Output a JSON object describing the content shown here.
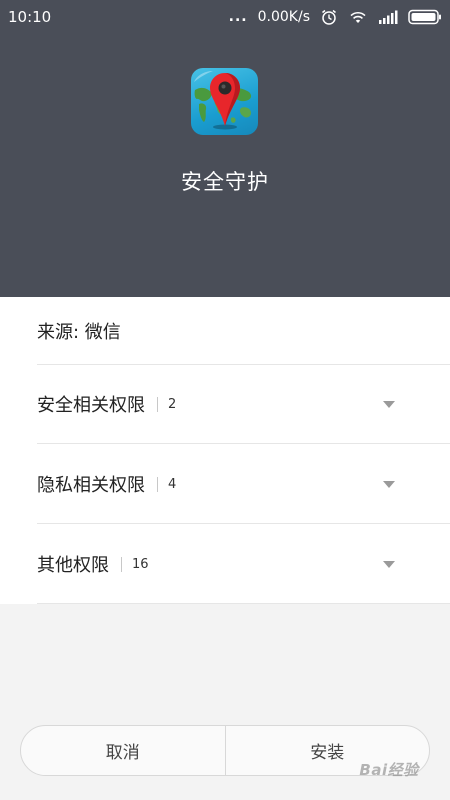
{
  "status_bar": {
    "time": "10:10",
    "dots": "...",
    "speed": "0.00K/s"
  },
  "app": {
    "name": "安全守护",
    "icon": "map-pin-globe-icon"
  },
  "source": {
    "label": "来源: 微信"
  },
  "permissions": [
    {
      "label": "安全相关权限",
      "count": "2"
    },
    {
      "label": "隐私相关权限",
      "count": "4"
    },
    {
      "label": "其他权限",
      "count": "16"
    }
  ],
  "buttons": {
    "cancel": "取消",
    "install": "安装"
  },
  "colors": {
    "header_bg": "#4a4e58",
    "card_bg": "#ffffff",
    "page_bg": "#f3f3f3",
    "pin_red": "#e8262b"
  },
  "watermark": "Bai经验"
}
